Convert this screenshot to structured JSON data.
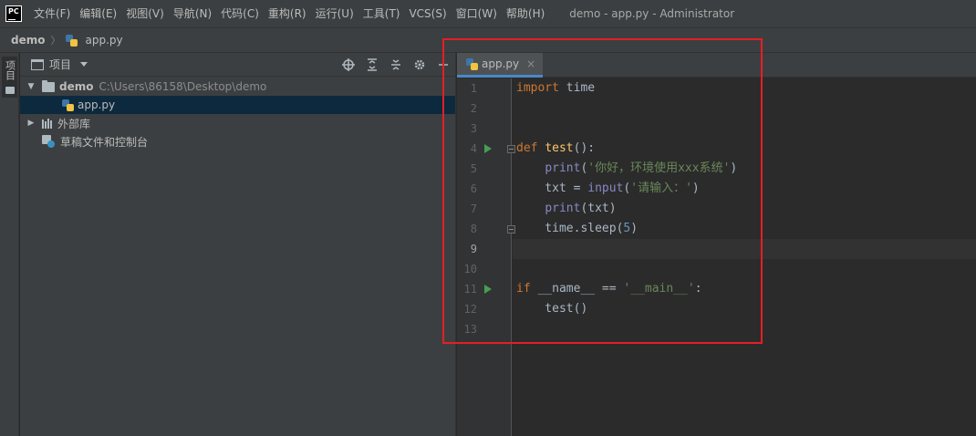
{
  "app": {
    "logo_text": "PC",
    "window_title": "demo - app.py - Administrator"
  },
  "menu": [
    "文件(F)",
    "编辑(E)",
    "视图(V)",
    "导航(N)",
    "代码(C)",
    "重构(R)",
    "运行(U)",
    "工具(T)",
    "VCS(S)",
    "窗口(W)",
    "帮助(H)"
  ],
  "breadcrumb": {
    "project": "demo",
    "file": "app.py"
  },
  "toolstrip": {
    "project_tab": "项目"
  },
  "project_panel": {
    "title": "项目",
    "icons": [
      "locate-icon",
      "expand-all-icon",
      "collapse-all-icon",
      "gear-icon",
      "minimize-icon"
    ],
    "tree": {
      "root_name": "demo",
      "root_path": "C:\\Users\\86158\\Desktop\\demo",
      "file": "app.py",
      "external_libs": "外部库",
      "scratches": "草稿文件和控制台"
    }
  },
  "editor": {
    "tab_label": "app.py",
    "current_line": 9,
    "lines": [
      {
        "n": "1",
        "html": "<span class='kw'>import</span> time"
      },
      {
        "n": "2",
        "html": ""
      },
      {
        "n": "3",
        "html": ""
      },
      {
        "n": "4",
        "html": "<span class='kw'>def</span> <span class='fn'>test</span>():"
      },
      {
        "n": "5",
        "html": "    <span class='bi'>print</span>(<span class='str'>'你好，环境使用xxx系统'</span>)"
      },
      {
        "n": "6",
        "html": "    txt = <span class='bi'>input</span>(<span class='str'>'请输入：'</span>)"
      },
      {
        "n": "7",
        "html": "    <span class='bi'>print</span>(txt)"
      },
      {
        "n": "8",
        "html": "    time.sleep(<span class='num'>5</span>)"
      },
      {
        "n": "9",
        "html": ""
      },
      {
        "n": "10",
        "html": ""
      },
      {
        "n": "11",
        "html": "<span class='kw'>if</span> __name__ == <span class='str'>'__main__'</span>:"
      },
      {
        "n": "12",
        "html": "    test()"
      },
      {
        "n": "13",
        "html": ""
      }
    ],
    "run_markers": [
      "4",
      "11"
    ],
    "fold_markers": [
      "4",
      "8"
    ]
  },
  "colors": {
    "annotation_box": "#e51e25",
    "selection": "#0d293e",
    "tab_accent": "#4a88c7"
  }
}
